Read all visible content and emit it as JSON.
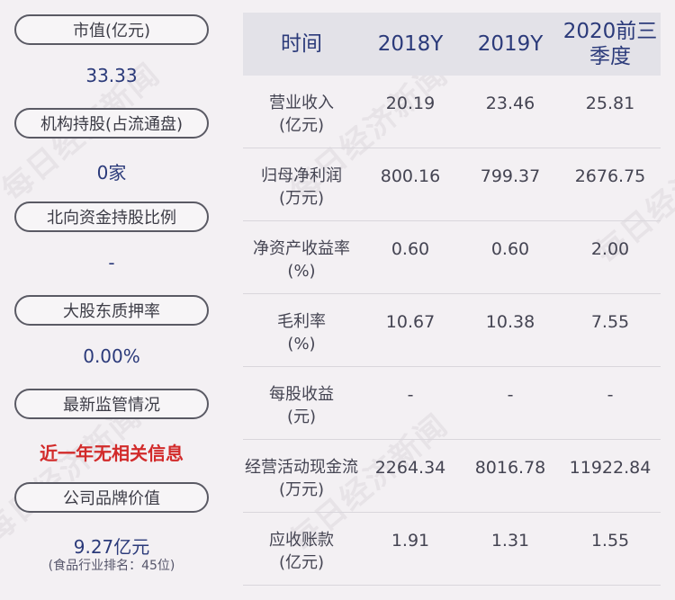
{
  "left_panel": [
    {
      "label": "市值(亿元)",
      "value": "33.33",
      "red": false
    },
    {
      "label": "机构持股(占流通盘)",
      "value": "0家",
      "red": false
    },
    {
      "label": "北向资金持股比例",
      "value": "-",
      "red": false
    },
    {
      "label": "大股东质押率",
      "value": "0.00%",
      "red": false
    },
    {
      "label": "最新监管情况",
      "value": "近一年无相关信息",
      "red": true
    },
    {
      "label": "公司品牌价值",
      "value": "9.27亿元",
      "red": false,
      "sub": "(食品行业排名：45位)"
    }
  ],
  "table": {
    "headers": [
      "时间",
      "2018Y",
      "2019Y",
      "2020前三季度"
    ],
    "rows": [
      {
        "label1": "营业收入",
        "label2": "(亿元)",
        "v": [
          "20.19",
          "23.46",
          "25.81"
        ]
      },
      {
        "label1": "归母净利润",
        "label2": "(万元)",
        "v": [
          "800.16",
          "799.37",
          "2676.75"
        ]
      },
      {
        "label1": "净资产收益率",
        "label2": "(%)",
        "v": [
          "0.60",
          "0.60",
          "2.00"
        ]
      },
      {
        "label1": "毛利率",
        "label2": "(%)",
        "v": [
          "10.67",
          "10.38",
          "7.55"
        ]
      },
      {
        "label1": "每股收益",
        "label2": "(元)",
        "v": [
          "-",
          "-",
          "-"
        ]
      },
      {
        "label1": "经营活动现金流",
        "label2": "(万元)",
        "v": [
          "2264.34",
          "8016.78",
          "11922.84"
        ]
      },
      {
        "label1": "应收账款",
        "label2": "(亿元)",
        "v": [
          "1.91",
          "1.31",
          "1.55"
        ]
      }
    ]
  },
  "watermark": "每日经济新闻",
  "colors": {
    "value_blue": "#2b3a7a",
    "alert_red": "#d22a2a",
    "header_bg": "#e3e2e8"
  }
}
